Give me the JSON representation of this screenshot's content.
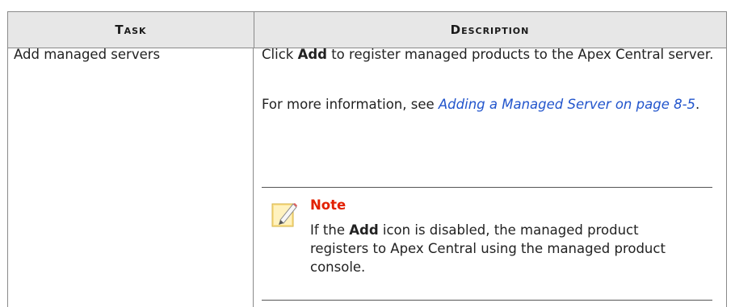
{
  "table": {
    "headers": {
      "task": "Task",
      "description": "Description"
    },
    "row": {
      "task": "Add managed servers",
      "desc1_pre": "Click ",
      "desc1_bold": "Add",
      "desc1_post": " to register managed products to the Apex Central server.",
      "desc2_pre": "For more information, see ",
      "desc2_link": "Adding a Managed Server on page 8-5",
      "desc2_post": ".",
      "note": {
        "title": "Note",
        "body_pre": "If the ",
        "body_bold": "Add",
        "body_post": " icon is disabled, the managed product registers to Apex Central using the managed product console."
      }
    }
  },
  "colors": {
    "header_bg": "#e7e7e7",
    "link": "#2255cc",
    "note_title": "#e22000"
  },
  "icons": {
    "note": "note-pencil-icon"
  }
}
